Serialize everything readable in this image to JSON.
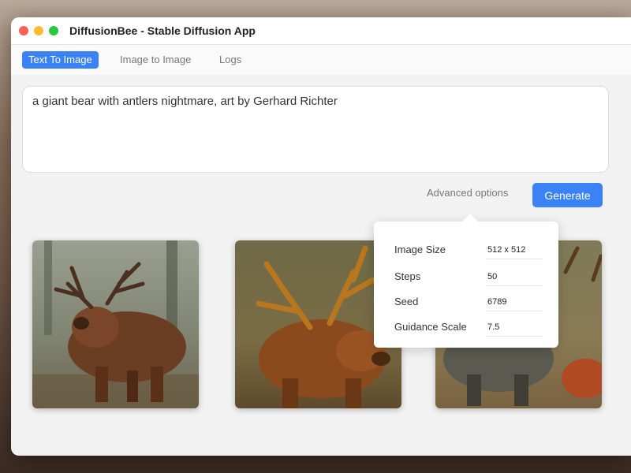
{
  "window": {
    "title": "DiffusionBee - Stable Diffusion App"
  },
  "tabs": [
    {
      "label": "Text To Image",
      "active": true
    },
    {
      "label": "Image to Image",
      "active": false
    },
    {
      "label": "Logs",
      "active": false
    }
  ],
  "prompt": {
    "value": "a giant bear with antlers nightmare, art by Gerhard Richter"
  },
  "actions": {
    "advanced_label": "Advanced options",
    "generate_label": "Generate"
  },
  "advanced": {
    "image_size": {
      "label": "Image Size",
      "value": "512 x 512"
    },
    "steps": {
      "label": "Steps",
      "value": "50"
    },
    "seed": {
      "label": "Seed",
      "value": "6789"
    },
    "guidance": {
      "label": "Guidance Scale",
      "value": "7.5"
    }
  },
  "results": [
    {
      "name": "generated-image-1",
      "subject": "brown-bear-with-antlers"
    },
    {
      "name": "generated-image-2",
      "subject": "orange-bear-with-large-antlers"
    },
    {
      "name": "generated-image-3",
      "subject": "gray-bear-partially-hidden"
    }
  ],
  "colors": {
    "accent": "#3b82f6",
    "close": "#fe5f57",
    "minimize": "#febc2e",
    "maximize": "#28c840"
  }
}
